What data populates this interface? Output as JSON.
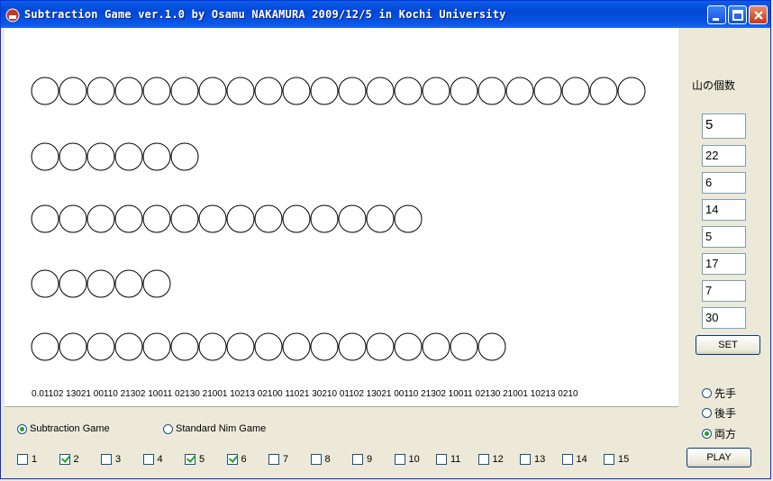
{
  "window": {
    "title": "Subtraction Game ver.1.0 by Osamu NAKAMURA 2009/12/5 in Kochi University"
  },
  "piles": [
    22,
    6,
    14,
    5,
    17
  ],
  "binary_text": "0.01102 13021  00110 21302  10011 02130  21001 10213  02100 11021  30210 01102  13021 00110  21302 10011  02130 21001  10213 0210",
  "game_mode": {
    "options": [
      "Subtraction Game",
      "Standard Nim Game"
    ],
    "selected": "Subtraction Game"
  },
  "subtraction_set": [
    {
      "label": "1",
      "checked": false
    },
    {
      "label": "2",
      "checked": true
    },
    {
      "label": "3",
      "checked": false
    },
    {
      "label": "4",
      "checked": false
    },
    {
      "label": "5",
      "checked": true
    },
    {
      "label": "6",
      "checked": true
    },
    {
      "label": "7",
      "checked": false
    },
    {
      "label": "8",
      "checked": false
    },
    {
      "label": "9",
      "checked": false
    },
    {
      "label": "10",
      "checked": false
    },
    {
      "label": "11",
      "checked": false
    },
    {
      "label": "12",
      "checked": false
    },
    {
      "label": "13",
      "checked": false
    },
    {
      "label": "14",
      "checked": false
    },
    {
      "label": "15",
      "checked": false
    }
  ],
  "side": {
    "label": "山の個数",
    "inputs": [
      "5",
      "22",
      "6",
      "14",
      "5",
      "17",
      "7",
      "30"
    ],
    "set_label": "SET",
    "order_options": [
      "先手",
      "後手",
      "両方"
    ],
    "order_selected": "両方",
    "play_label": "PLAY"
  },
  "icons": {
    "app": "red-helmet-icon",
    "minimize": "minimize-icon",
    "maximize": "maximize-icon",
    "close": "close-icon"
  }
}
